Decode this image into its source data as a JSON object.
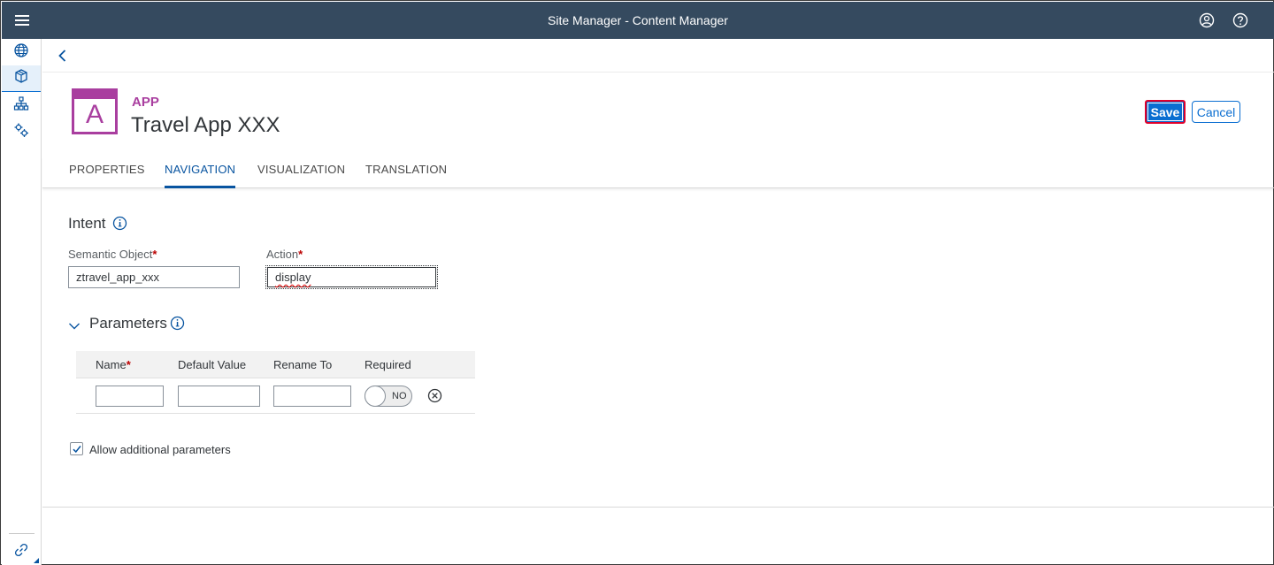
{
  "shell": {
    "title": "Site Manager - Content Manager",
    "icons": [
      "menu-icon",
      "user-profile-icon",
      "help-icon"
    ]
  },
  "sidenav": {
    "items": [
      {
        "icon": "globe-icon",
        "label": "Sites"
      },
      {
        "icon": "product-icon",
        "label": "Content Manager",
        "selected": true
      },
      {
        "icon": "hierarchy-icon",
        "label": "Hierarchy"
      },
      {
        "icon": "settings-icon",
        "label": "Settings"
      }
    ],
    "bottom_icon": "link-icon"
  },
  "header": {
    "type_label": "APP",
    "title": "Travel App XXX",
    "icon_letter": "A",
    "save_label": "Save",
    "cancel_label": "Cancel"
  },
  "tabs": [
    {
      "label": "PROPERTIES",
      "active": false
    },
    {
      "label": "NAVIGATION",
      "active": true
    },
    {
      "label": "VISUALIZATION",
      "active": false
    },
    {
      "label": "TRANSLATION",
      "active": false
    }
  ],
  "intent": {
    "title": "Intent",
    "semantic_object_label": "Semantic Object",
    "semantic_object_value": "ztravel_app_xxx",
    "action_label": "Action",
    "action_value": "display",
    "required_marker": "*"
  },
  "parameters": {
    "title": "Parameters",
    "columns": [
      "Name",
      "Default Value",
      "Rename To",
      "Required"
    ],
    "rows": [
      {
        "name": "",
        "default_value": "",
        "rename_to": "",
        "required": "NO"
      }
    ],
    "allow_additional_label": "Allow additional parameters",
    "allow_additional_checked": true
  },
  "colors": {
    "shell_bg": "#354a5f",
    "accent": "#0a6ed1",
    "app_icon": "#a93e9f",
    "required": "#bb0000"
  }
}
